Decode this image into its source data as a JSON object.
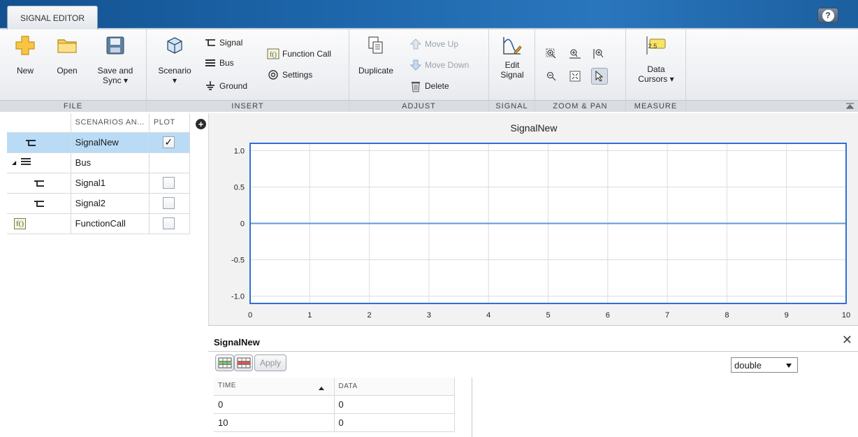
{
  "tabs": {
    "active": "SIGNAL EDITOR",
    "help": "?"
  },
  "ribbon": {
    "file": {
      "label": "FILE",
      "new": "New",
      "open": "Open",
      "save_and_sync_line1": "Save and",
      "save_and_sync_line2": "Sync"
    },
    "insert": {
      "label": "INSERT",
      "scenario": "Scenario",
      "signal": "Signal",
      "bus": "Bus",
      "ground": "Ground",
      "function_call": "Function Call",
      "settings": "Settings"
    },
    "adjust": {
      "label": "ADJUST",
      "duplicate": "Duplicate",
      "move_up": "Move Up",
      "move_down": "Move Down",
      "delete": "Delete"
    },
    "signal": {
      "label": "SIGNAL",
      "edit_signal_line1": "Edit",
      "edit_signal_line2": "Signal"
    },
    "zoom_pan": {
      "label": "ZOOM & PAN"
    },
    "measure": {
      "label": "MEASURE",
      "data_cursors_badge": "2.5",
      "data_cursors_line1": "Data",
      "data_cursors_line2": "Cursors"
    }
  },
  "tree": {
    "header_name": "SCENARIOS AN...",
    "header_plot": "PLOT",
    "rows": [
      {
        "name": "SignalNew",
        "icon": "signal-icon",
        "plot": "checked",
        "check_mark": "✓"
      },
      {
        "name": "Bus",
        "icon": "bus-icon",
        "plot": "none",
        "expand_glyph": "◢"
      },
      {
        "name": "Signal1",
        "icon": "signal-icon",
        "plot": "unchecked"
      },
      {
        "name": "Signal2",
        "icon": "signal-icon",
        "plot": "unchecked"
      },
      {
        "name": "FunctionCall",
        "icon": "function-call-icon",
        "plot": "unchecked",
        "icon_text": "f()"
      }
    ],
    "add_column": "+"
  },
  "chart_data": {
    "type": "line",
    "title": "SignalNew",
    "xlim": [
      0,
      10
    ],
    "ylim": [
      -1.1,
      1.1
    ],
    "x_ticks": [
      "0",
      "1",
      "2",
      "3",
      "4",
      "5",
      "6",
      "7",
      "8",
      "9",
      "10"
    ],
    "y_ticks": [
      "1.0",
      "0.5",
      "0",
      "-0.5",
      "-1.0"
    ],
    "y_tick_values": [
      1.0,
      0.5,
      0,
      -0.5,
      -1.0
    ],
    "grid": true,
    "series": [
      {
        "x": [
          0,
          10
        ],
        "y": [
          0,
          0
        ],
        "color": "#5b9bd5"
      }
    ],
    "frame_color": "#2f6fd6"
  },
  "data_panel": {
    "title": "SignalNew",
    "close": "✕",
    "apply": "Apply",
    "type_value": "double",
    "columns": [
      "TIME",
      "DATA"
    ],
    "rows": [
      [
        "0",
        "0"
      ],
      [
        "10",
        "0"
      ]
    ]
  }
}
